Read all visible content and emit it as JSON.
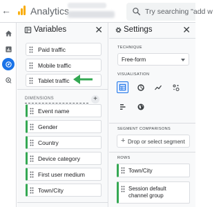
{
  "header": {
    "app_title": "Analytics",
    "search_placeholder": "Try searching \"add w"
  },
  "rail": {
    "items": [
      {
        "icon": "home-icon"
      },
      {
        "icon": "reports-icon"
      },
      {
        "icon": "explore-icon",
        "active": true
      },
      {
        "icon": "advertising-icon"
      }
    ]
  },
  "variables_panel": {
    "title": "Variables",
    "metrics": [
      {
        "label": "Paid traffic"
      },
      {
        "label": "Mobile traffic"
      },
      {
        "label": "Tablet traffic"
      }
    ],
    "dimensions_label": "DIMENSIONS",
    "dimensions": [
      {
        "label": "Event name"
      },
      {
        "label": "Gender"
      },
      {
        "label": "Country"
      },
      {
        "label": "Device category"
      },
      {
        "label": "First user medium"
      },
      {
        "label": "Town/City"
      }
    ]
  },
  "settings_panel": {
    "title": "Settings",
    "technique_label": "TECHNIQUE",
    "technique_value": "Free-form",
    "visualisation_label": "VISUALISATION",
    "visualisations": [
      {
        "icon": "table-icon",
        "active": true
      },
      {
        "icon": "donut-chart-icon"
      },
      {
        "icon": "line-chart-icon"
      },
      {
        "icon": "scatter-plot-icon"
      },
      {
        "icon": "bar-chart-icon"
      },
      {
        "icon": "geo-map-icon"
      }
    ],
    "segment_label": "SEGMENT COMPARISONS",
    "segment_drop": "Drop or select segment",
    "rows_label": "ROWS",
    "rows": [
      {
        "label": "Town/City"
      },
      {
        "label": "Session default channel group"
      }
    ]
  },
  "colors": {
    "accent": "#1a73e8",
    "dimension": "#34a853",
    "logo": "#f9ab00"
  }
}
